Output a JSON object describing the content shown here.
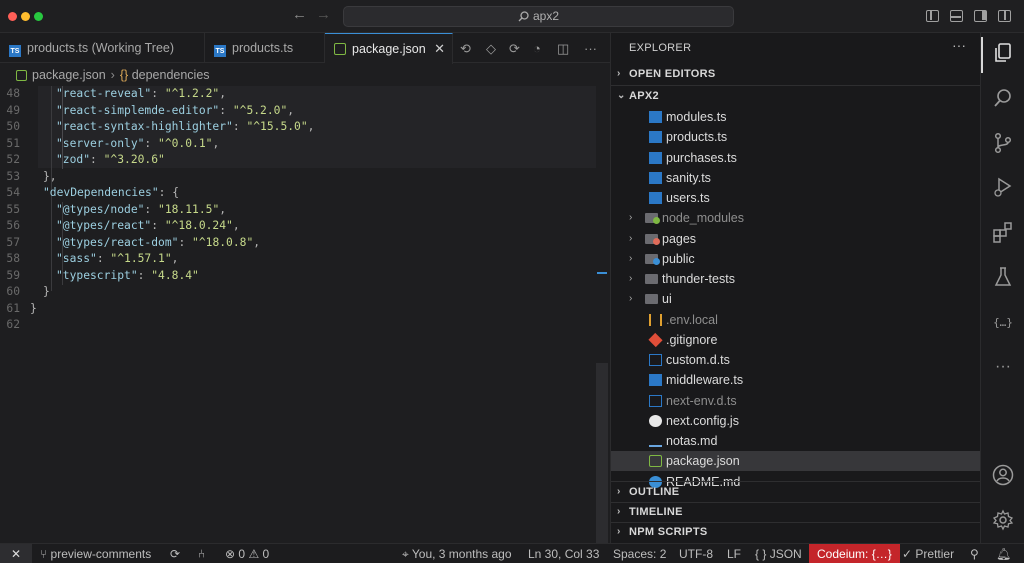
{
  "titlebar": {
    "search_text": "apx2",
    "back_icon": "arrow-left-icon",
    "forward_icon": "arrow-right-icon"
  },
  "tabs": [
    {
      "label": "products.ts (Working Tree)",
      "type": "ts"
    },
    {
      "label": "products.ts",
      "type": "ts"
    },
    {
      "label": "package.json",
      "type": "json",
      "active": true
    }
  ],
  "breadcrumb": {
    "file": "package.json",
    "brace": "{}",
    "symbol": "dependencies"
  },
  "code": {
    "lines": [
      {
        "n": "48",
        "key": "\"react-reveal\"",
        "val": "\"^1.2.2\"",
        "tail": ",",
        "indent": 2
      },
      {
        "n": "49",
        "key": "\"react-simplemde-editor\"",
        "val": "\"^5.2.0\"",
        "tail": ",",
        "indent": 2
      },
      {
        "n": "50",
        "key": "\"react-syntax-highlighter\"",
        "val": "\"^15.5.0\"",
        "tail": ",",
        "indent": 2
      },
      {
        "n": "51",
        "key": "\"server-only\"",
        "val": "\"^0.0.1\"",
        "tail": ",",
        "indent": 2
      },
      {
        "n": "52",
        "key": "\"zod\"",
        "val": "\"^3.20.6\"",
        "tail": "",
        "indent": 2
      },
      {
        "n": "53",
        "raw": "},",
        "indent": 1
      },
      {
        "n": "54",
        "key": "\"devDependencies\"",
        "val": "{",
        "tail": "",
        "indent": 1,
        "open": true
      },
      {
        "n": "55",
        "key": "\"@types/node\"",
        "val": "\"18.11.5\"",
        "tail": ",",
        "indent": 2
      },
      {
        "n": "56",
        "key": "\"@types/react\"",
        "val": "\"^18.0.24\"",
        "tail": ",",
        "indent": 2
      },
      {
        "n": "57",
        "key": "\"@types/react-dom\"",
        "val": "\"^18.0.8\"",
        "tail": ",",
        "indent": 2
      },
      {
        "n": "58",
        "key": "\"sass\"",
        "val": "\"^1.57.1\"",
        "tail": ",",
        "indent": 2
      },
      {
        "n": "59",
        "key": "\"typescript\"",
        "val": "\"4.8.4\"",
        "tail": "",
        "indent": 2
      },
      {
        "n": "60",
        "raw": "}",
        "indent": 1
      },
      {
        "n": "61",
        "raw": "}",
        "indent": 0
      },
      {
        "n": "62",
        "raw": "",
        "indent": 0
      }
    ]
  },
  "explorer": {
    "title": "EXPLORER",
    "more": "···",
    "open_editors": "OPEN EDITORS",
    "project": "APX2",
    "items": [
      {
        "label": "modules.ts",
        "kind": "ts",
        "depth": 2
      },
      {
        "label": "products.ts",
        "kind": "ts",
        "depth": 2
      },
      {
        "label": "purchases.ts",
        "kind": "ts",
        "depth": 2
      },
      {
        "label": "sanity.ts",
        "kind": "ts",
        "depth": 2
      },
      {
        "label": "users.ts",
        "kind": "ts",
        "depth": 2
      },
      {
        "label": "node_modules",
        "kind": "folder",
        "color": "#7fb843",
        "dim": true
      },
      {
        "label": "pages",
        "kind": "folder",
        "color": "#e06c5a"
      },
      {
        "label": "public",
        "kind": "folder",
        "color": "#3a8fd6"
      },
      {
        "label": "thunder-tests",
        "kind": "folder",
        "color": "#8a8a8a"
      },
      {
        "label": "ui",
        "kind": "folder",
        "color": "#8a8a8a"
      },
      {
        "label": ".env.local",
        "kind": "env",
        "dim": true
      },
      {
        "label": ".gitignore",
        "kind": "git"
      },
      {
        "label": "custom.d.ts",
        "kind": "dts"
      },
      {
        "label": "middleware.ts",
        "kind": "ts"
      },
      {
        "label": "next-env.d.ts",
        "kind": "dts",
        "dim": true
      },
      {
        "label": "next.config.js",
        "kind": "next"
      },
      {
        "label": "notas.md",
        "kind": "md"
      },
      {
        "label": "package.json",
        "kind": "json",
        "selected": true
      },
      {
        "label": "README.md",
        "kind": "info"
      }
    ],
    "outline": "OUTLINE",
    "timeline": "TIMELINE",
    "npm_scripts": "NPM SCRIPTS"
  },
  "statusbar": {
    "remote": "✕",
    "branch": "preview-comments",
    "errors": "0",
    "warnings": "0",
    "blame": "You, 3 months ago",
    "position": "Ln 30, Col 33",
    "spaces": "Spaces: 2",
    "encoding": "UTF-8",
    "eol": "LF",
    "language": "JSON",
    "codeium": "Codeium: {…}",
    "prettier": "✓ Prettier"
  },
  "colors": {
    "accent": "#3a8fd6",
    "codeium_bg": "#c4252a"
  }
}
